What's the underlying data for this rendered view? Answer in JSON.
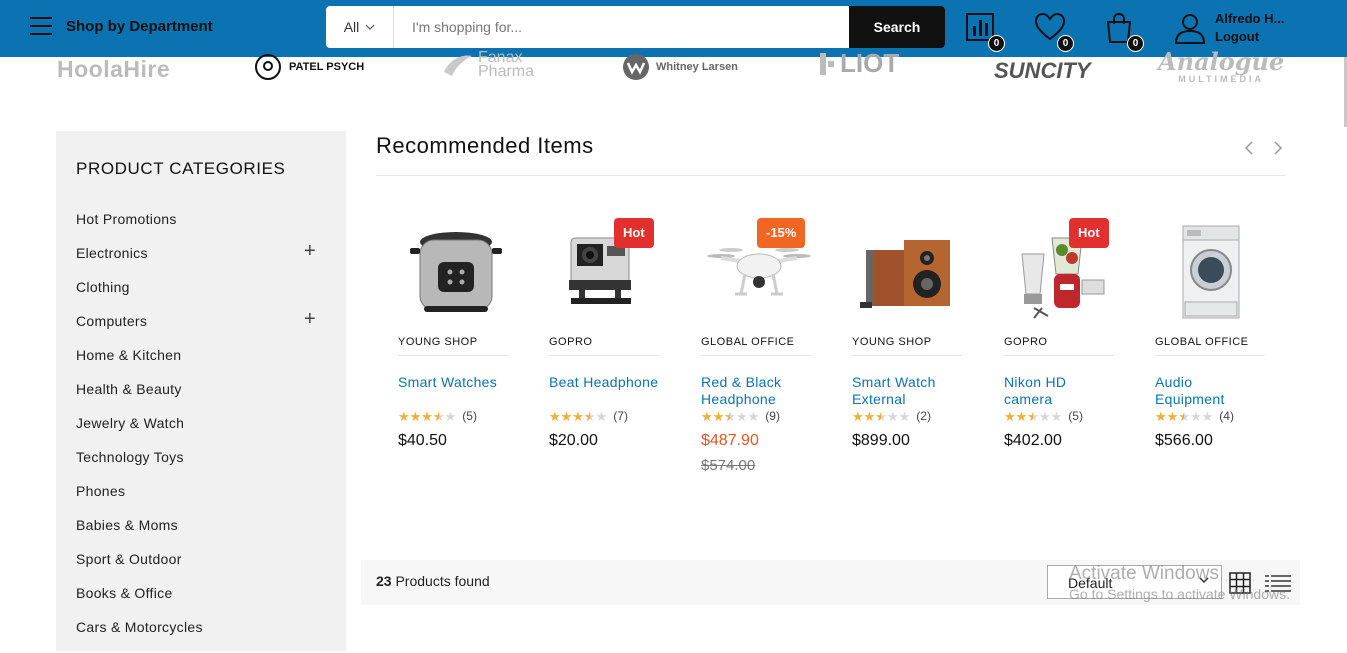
{
  "header": {
    "department_label": "Shop by Department",
    "search": {
      "category": "All",
      "placeholder": "I'm shopping for...",
      "button": "Search"
    },
    "compare_count": "0",
    "wishlist_count": "0",
    "cart_count": "0",
    "user_name": "Alfredo H...",
    "logout": "Logout"
  },
  "brands": [
    "HoolaHire",
    "PATEL PSYCH",
    "Fanax Pharma",
    "Whitney Larsen",
    "LIOT",
    "SUNCITY",
    "Analogue",
    "MULTIMEDIA"
  ],
  "sidebar": {
    "title": "PRODUCT CATEGORIES",
    "categories": [
      {
        "label": "Hot Promotions",
        "expand": ""
      },
      {
        "label": "Electronics",
        "expand": "+"
      },
      {
        "label": "Clothing",
        "expand": ""
      },
      {
        "label": "Computers",
        "expand": "+"
      },
      {
        "label": "Home & Kitchen",
        "expand": ""
      },
      {
        "label": "Health & Beauty",
        "expand": ""
      },
      {
        "label": "Jewelry & Watch",
        "expand": ""
      },
      {
        "label": "Technology Toys",
        "expand": ""
      },
      {
        "label": "Phones",
        "expand": ""
      },
      {
        "label": "Babies & Moms",
        "expand": ""
      },
      {
        "label": "Sport & Outdoor",
        "expand": ""
      },
      {
        "label": "Books & Office",
        "expand": ""
      },
      {
        "label": "Cars & Motorcycles",
        "expand": ""
      }
    ]
  },
  "recommended": {
    "title": "Recommended Items",
    "prev_icon": "chevron-left-icon",
    "next_icon": "chevron-right-icon",
    "products": [
      {
        "vendor": "YOUNG SHOP",
        "name": "Smart Watches",
        "rating": 3.5,
        "reviews": "(5)",
        "price": "$40.50",
        "old_price": "",
        "tag": "",
        "image": "rice-cooker"
      },
      {
        "vendor": "GOPRO",
        "name": "Beat Headphone",
        "rating": 3.5,
        "reviews": "(7)",
        "price": "$20.00",
        "old_price": "",
        "tag": "Hot",
        "image": "action-camera"
      },
      {
        "vendor": "GLOBAL OFFICE",
        "name": "Red & Black Headphone",
        "rating": 2.5,
        "reviews": "(9)",
        "price": "$487.90",
        "old_price": "$574.00",
        "tag": "-15%",
        "image": "drone"
      },
      {
        "vendor": "YOUNG SHOP",
        "name": "Smart Watch External",
        "rating": 2.5,
        "reviews": "(2)",
        "price": "$899.00",
        "old_price": "",
        "tag": "",
        "image": "speakers"
      },
      {
        "vendor": "GOPRO",
        "name": "Nikon HD camera",
        "rating": 2.5,
        "reviews": "(5)",
        "price": "$402.00",
        "old_price": "",
        "tag": "Hot",
        "image": "blender"
      },
      {
        "vendor": "GLOBAL OFFICE",
        "name": "Audio Equipment",
        "rating": 2.5,
        "reviews": "(4)",
        "price": "$566.00",
        "old_price": "",
        "tag": "",
        "image": "washing-machine"
      }
    ]
  },
  "results": {
    "count": "23",
    "label": "Products found",
    "sort": "Default"
  },
  "watermark": {
    "line1": "Activate Windows",
    "line2": "Go to Settings to activate Windows."
  },
  "colors": {
    "header_bg": "#0b73b1",
    "link": "#0b73b1",
    "hot_tag": "#e2302f",
    "sale_tag": "#f26522",
    "sale_price": "#e85322",
    "star": "#f0b134"
  }
}
